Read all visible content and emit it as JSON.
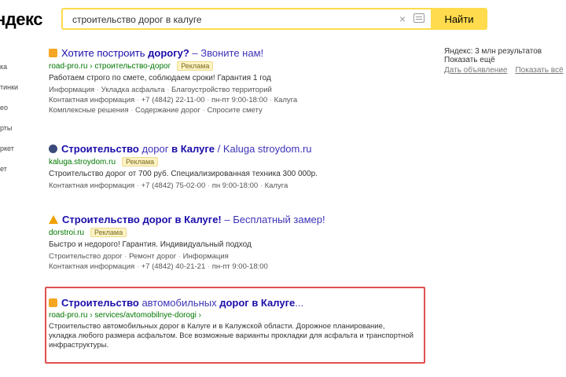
{
  "logo": "ндекс",
  "search": {
    "value": "строительство дорог в калуге",
    "button_label": "Найти"
  },
  "left_nav": [
    "ка",
    "тинки",
    "ео",
    "рты",
    "ркет",
    "ет"
  ],
  "results": [
    {
      "title_pre": "Хотите построить ",
      "title_bold": "дорогу?",
      "title_post": " – Звоните нам!",
      "url": "road-pro.ru › строительство-дорог",
      "badge": "Реклама",
      "text": "Работаем строго по смете, соблюдаем сроки! Гарантия 1 год",
      "links": [
        "Информация",
        "Укладка асфальта",
        "Благоустройство территорий"
      ],
      "contacts": [
        "Контактная информация",
        "+7 (4842) 22-11-00",
        "пн-пт 9:00-18:00",
        "Калуга"
      ],
      "extra": [
        "Комплексные решения",
        "Содержание дорог",
        "Спросите смету"
      ]
    },
    {
      "title_bold": "Строительство",
      "title_post": " дорог ",
      "title_bold2": "в Калуге",
      "title_tail": " / Kaluga stroydom.ru",
      "url": "kaluga.stroydom.ru",
      "badge": "Реклама",
      "text": "Строительство дорог от 700 руб. Специализированная техника 300 000р.",
      "contacts": [
        "Контактная информация",
        "+7 (4842) 75-02-00",
        "пн 9:00-18:00",
        "Калуга"
      ]
    },
    {
      "title_bold": "Строительство дорог в Калуге!",
      "title_post": " – Бесплатный замер!",
      "url": "dorstroi.ru",
      "badge": "Реклама",
      "text": "Быстро и недорого! Гарантия. Индивидуальный подход",
      "links": [
        "Строительство дорог",
        "Ремонт дорог",
        "Информация"
      ],
      "contacts": [
        "Контактная информация",
        "+7 (4842) 40-21-21",
        "пн-пт 9:00-18:00"
      ]
    },
    {
      "title_bold": "Строительство",
      "title_post": " автомобильных ",
      "title_bold2": "дорог в Калуге",
      "title_tail": "...",
      "url": "road-pro.ru › services/avtomobilnye-dorogi ›",
      "text": "Строительство автомобильных дорог в Калуге и в Калужской области. Дорожное планирование, укладка любого размера асфальтом. Все возможные варианты прокладки для асфальта и транспортной инфраструктуры."
    }
  ],
  "right_panel": {
    "title": "Яндекс: 3 млн результатов",
    "subtitle": "Показать ещё",
    "links": [
      "Дать объявление",
      "Показать всё"
    ]
  },
  "colors": {
    "accent": "#ffdb4d",
    "link": "#1a0dab",
    "url": "#007700",
    "highlight": "#e05050"
  }
}
